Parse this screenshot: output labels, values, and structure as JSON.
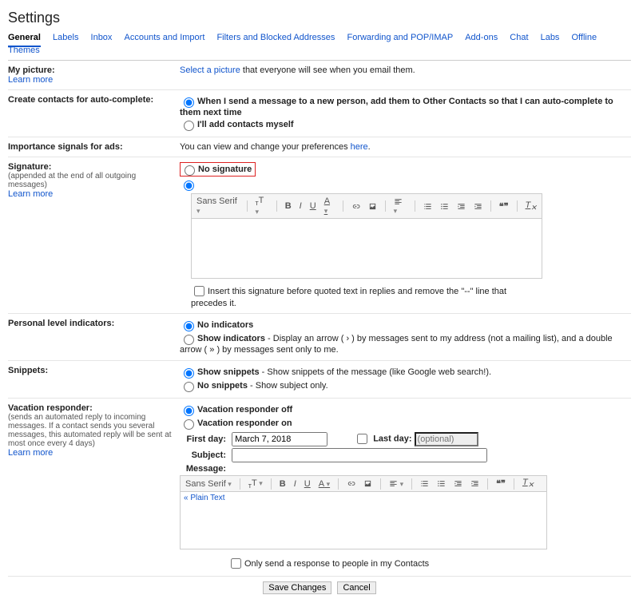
{
  "title": "Settings",
  "tabs": {
    "general": "General",
    "labels": "Labels",
    "inbox": "Inbox",
    "accounts": "Accounts and Import",
    "filters": "Filters and Blocked Addresses",
    "forwarding": "Forwarding and POP/IMAP",
    "addons": "Add-ons",
    "chat": "Chat",
    "labs": "Labs",
    "offline": "Offline",
    "themes": "Themes"
  },
  "picture": {
    "label": "My picture:",
    "learn": "Learn more",
    "select": "Select a picture",
    "rest": " that everyone will see when you email them."
  },
  "contacts": {
    "label": "Create contacts for auto-complete:",
    "opt1": "When I send a message to a new person, add them to Other Contacts so that I can auto-complete to them next time",
    "opt2": "I'll add contacts myself"
  },
  "ads": {
    "label": "Importance signals for ads:",
    "text": "You can view and change your preferences ",
    "link": "here",
    "dot": "."
  },
  "signature": {
    "label": "Signature:",
    "sub": "(appended at the end of all outgoing messages)",
    "learn": "Learn more",
    "none": "No signature",
    "font": "Sans Serif",
    "insert": "Insert this signature before quoted text in replies and remove the \"--\" line that precedes it."
  },
  "indicators": {
    "label": "Personal level indicators:",
    "opt1": "No indicators",
    "opt2b": "Show indicators",
    "opt2": " - Display an arrow ( › ) by messages sent to my address (not a mailing list), and a double arrow ( » ) by messages sent only to me."
  },
  "snippets": {
    "label": "Snippets:",
    "opt1b": "Show snippets",
    "opt1": " - Show snippets of the message (like Google web search!).",
    "opt2b": "No snippets",
    "opt2": " - Show subject only."
  },
  "vacation": {
    "label": "Vacation responder:",
    "sub": "(sends an automated reply to incoming messages. If a contact sends you several messages, this automated reply will be sent at most once every 4 days)",
    "learn": "Learn more",
    "off": "Vacation responder off",
    "on": "Vacation responder on",
    "firstday": "First day:",
    "firstday_val": "March 7, 2018",
    "lastday": "Last day:",
    "lastday_ph": "(optional)",
    "subject": "Subject:",
    "message": "Message:",
    "font": "Sans Serif",
    "plain": "« Plain Text",
    "contacts_only": "Only send a response to people in my Contacts"
  },
  "footer": {
    "save": "Save Changes",
    "cancel": "Cancel"
  }
}
